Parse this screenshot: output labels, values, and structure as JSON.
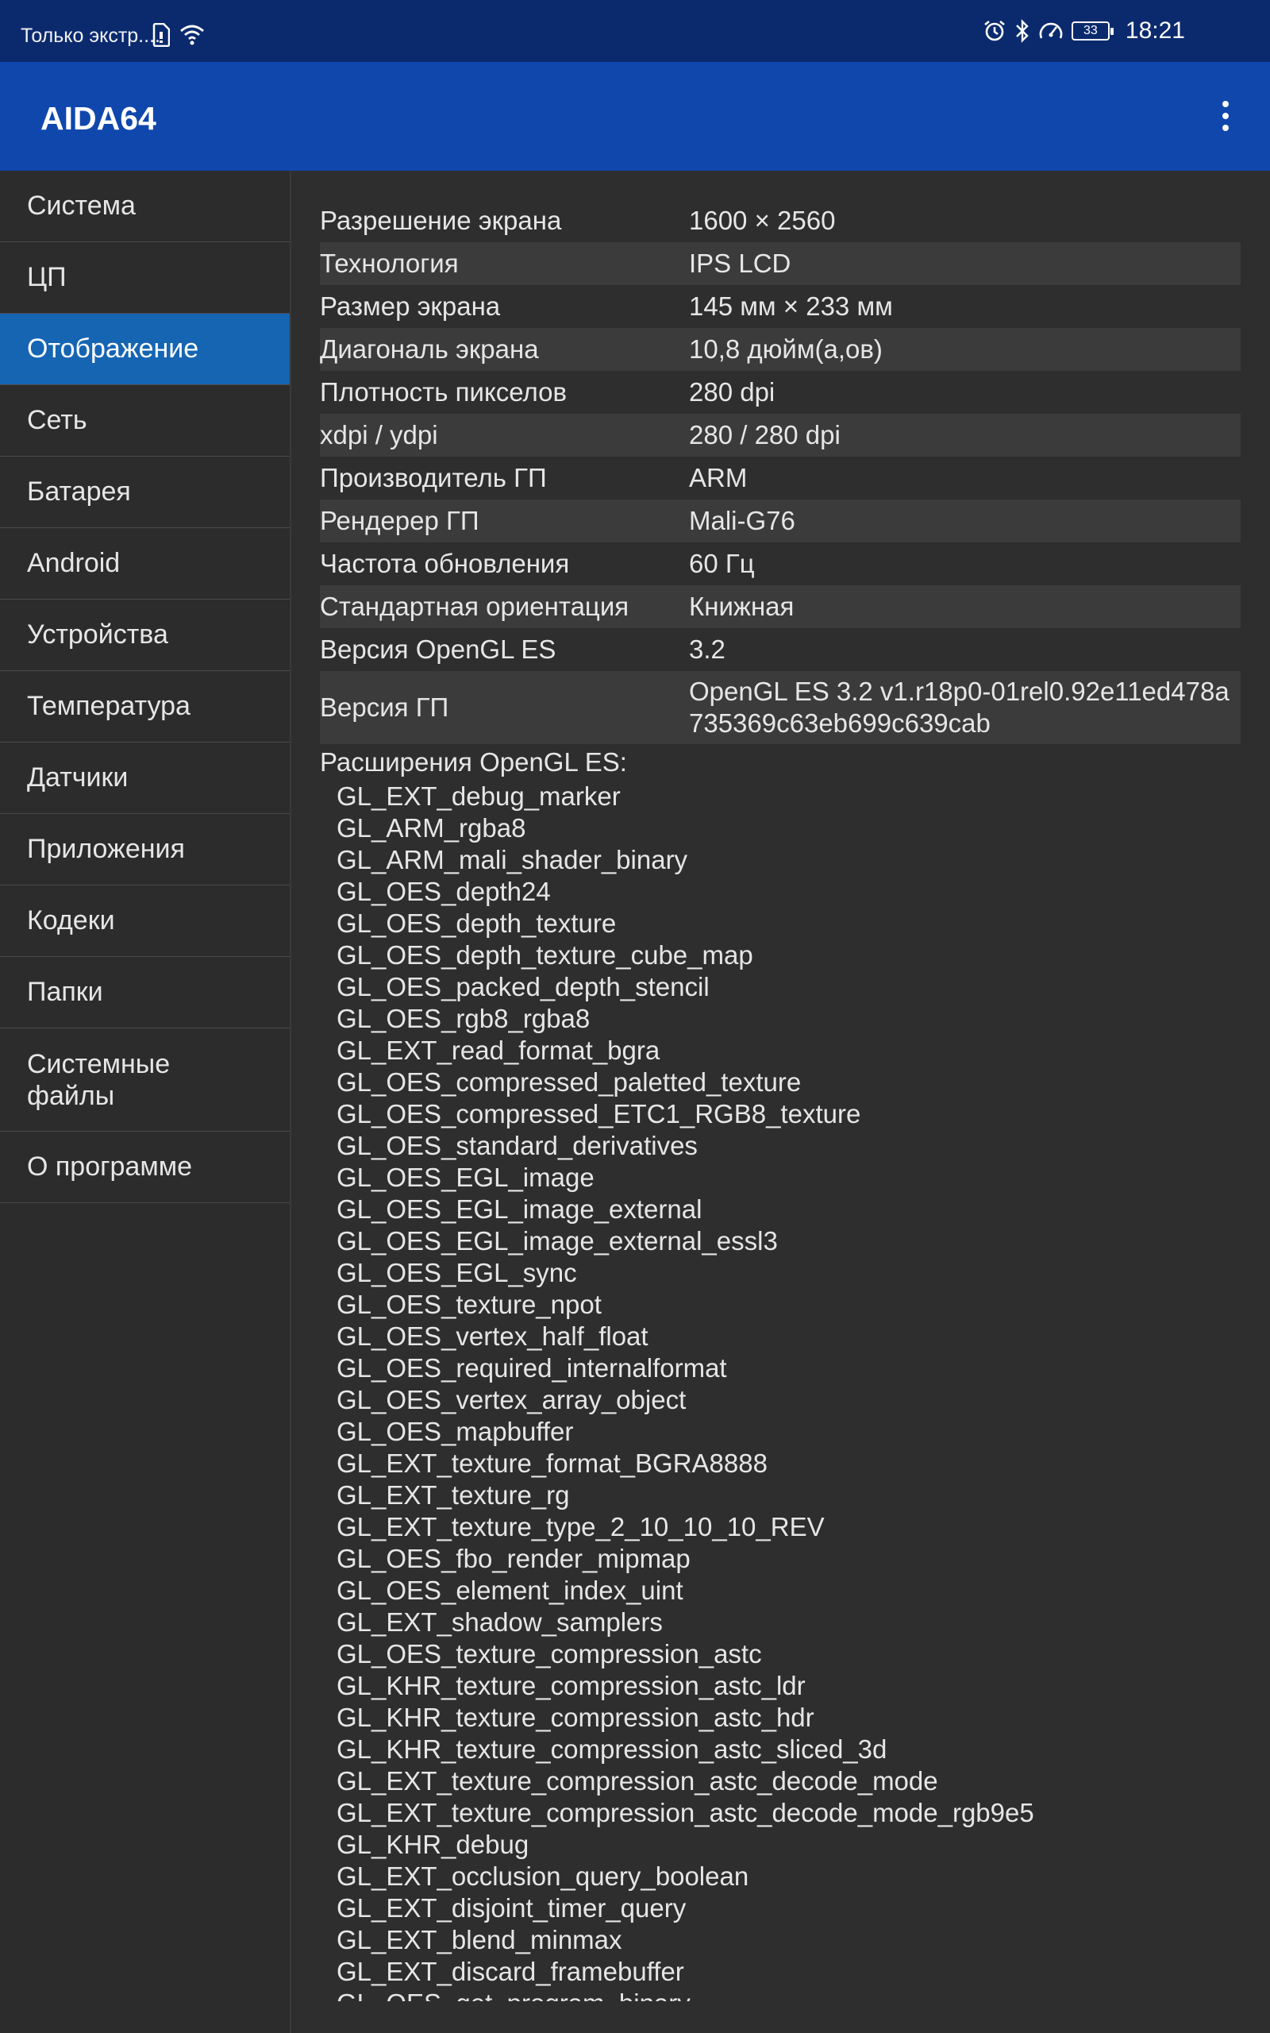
{
  "status_bar": {
    "carrier": "Только экстр....",
    "time": "18:21",
    "battery_level": "33",
    "icons_left": [
      "sim-card-icon",
      "wifi-icon"
    ],
    "icons_right": [
      "alarm-icon",
      "bluetooth-icon",
      "speedometer-icon",
      "battery-icon"
    ]
  },
  "app_bar": {
    "title": "AIDA64",
    "menu_icon": "more-vert-icon"
  },
  "sidebar": {
    "items": [
      {
        "label": "Система",
        "active": false
      },
      {
        "label": "ЦП",
        "active": false
      },
      {
        "label": "Отображение",
        "active": true
      },
      {
        "label": "Сеть",
        "active": false
      },
      {
        "label": "Батарея",
        "active": false
      },
      {
        "label": "Android",
        "active": false
      },
      {
        "label": "Устройства",
        "active": false
      },
      {
        "label": "Температура",
        "active": false
      },
      {
        "label": "Датчики",
        "active": false
      },
      {
        "label": "Приложения",
        "active": false
      },
      {
        "label": "Кодеки",
        "active": false
      },
      {
        "label": "Папки",
        "active": false
      },
      {
        "label": "Системные\nфайлы",
        "active": false
      },
      {
        "label": "О программе",
        "active": false
      }
    ]
  },
  "display_info": {
    "rows": [
      {
        "label": "Разрешение экрана",
        "value": "1600 × 2560"
      },
      {
        "label": "Технология",
        "value": "IPS LCD"
      },
      {
        "label": "Размер экрана",
        "value": "145 мм × 233 мм"
      },
      {
        "label": "Диагональ экрана",
        "value": "10,8 дюйм(а,ов)"
      },
      {
        "label": "Плотность пикселов",
        "value": "280 dpi"
      },
      {
        "label": "xdpi / ydpi",
        "value": "280 / 280 dpi"
      },
      {
        "label": "Производитель ГП",
        "value": "ARM"
      },
      {
        "label": "Рендерер ГП",
        "value": "Mali-G76"
      },
      {
        "label": "Частота обновления",
        "value": "60 Гц"
      },
      {
        "label": "Стандартная ориентация",
        "value": "Книжная"
      },
      {
        "label": "Версия OpenGL ES",
        "value": "3.2"
      },
      {
        "label": "Версия ГП",
        "value": "OpenGL ES 3.2 v1.r18p0-01rel0.92e11ed478a\n735369c63eb699c639cab"
      }
    ],
    "extensions_header": "Расширения OpenGL ES:",
    "extensions": [
      "GL_EXT_debug_marker",
      "GL_ARM_rgba8",
      "GL_ARM_mali_shader_binary",
      "GL_OES_depth24",
      "GL_OES_depth_texture",
      "GL_OES_depth_texture_cube_map",
      "GL_OES_packed_depth_stencil",
      "GL_OES_rgb8_rgba8",
      "GL_EXT_read_format_bgra",
      "GL_OES_compressed_paletted_texture",
      "GL_OES_compressed_ETC1_RGB8_texture",
      "GL_OES_standard_derivatives",
      "GL_OES_EGL_image",
      "GL_OES_EGL_image_external",
      "GL_OES_EGL_image_external_essl3",
      "GL_OES_EGL_sync",
      "GL_OES_texture_npot",
      "GL_OES_vertex_half_float",
      "GL_OES_required_internalformat",
      "GL_OES_vertex_array_object",
      "GL_OES_mapbuffer",
      "GL_EXT_texture_format_BGRA8888",
      "GL_EXT_texture_rg",
      "GL_EXT_texture_type_2_10_10_10_REV",
      "GL_OES_fbo_render_mipmap",
      "GL_OES_element_index_uint",
      "GL_EXT_shadow_samplers",
      "GL_OES_texture_compression_astc",
      "GL_KHR_texture_compression_astc_ldr",
      "GL_KHR_texture_compression_astc_hdr",
      "GL_KHR_texture_compression_astc_sliced_3d",
      "GL_EXT_texture_compression_astc_decode_mode",
      "GL_EXT_texture_compression_astc_decode_mode_rgb9e5",
      "GL_KHR_debug",
      "GL_EXT_occlusion_query_boolean",
      "GL_EXT_disjoint_timer_query",
      "GL_EXT_blend_minmax",
      "GL_EXT_discard_framebuffer",
      "GL_OES_get_program_binary"
    ]
  },
  "colors": {
    "status_bar_bg": "#0b2a6e",
    "app_bar_bg": "#0f47ad",
    "active_item_bg": "#1565b3",
    "background": "#2e2e2e",
    "alt_row_bg": "#3b3b3b",
    "text": "#e6e6e6"
  }
}
